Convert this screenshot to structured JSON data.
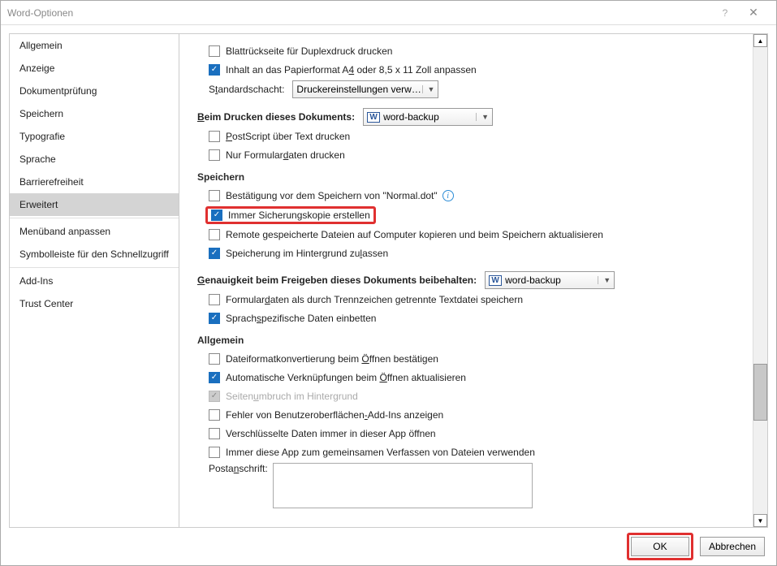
{
  "titlebar": {
    "title": "Word-Optionen",
    "help": "?",
    "close": "✕"
  },
  "sidebar": {
    "items": [
      {
        "label": "Allgemein"
      },
      {
        "label": "Anzeige"
      },
      {
        "label": "Dokumentprüfung"
      },
      {
        "label": "Speichern"
      },
      {
        "label": "Typografie"
      },
      {
        "label": "Sprache"
      },
      {
        "label": "Barrierefreiheit"
      },
      {
        "label": "Erweitert",
        "selected": true
      },
      {
        "sep": true
      },
      {
        "label": "Menüband anpassen"
      },
      {
        "label": "Symbolleiste für den Schnellzugriff"
      },
      {
        "sep": true
      },
      {
        "label": "Add-Ins"
      },
      {
        "label": "Trust Center"
      }
    ]
  },
  "content": {
    "duplex_cb": "Blattrückseite für Duplexdruck drucken",
    "paperfit_cb": "Inhalt an das Papierformat A4 oder 8,5 x 11 Zoll anpassen",
    "standardschacht_label": "Standardschacht:",
    "standardschacht_val": "Druckereinstellungen verw…",
    "print_doc_label": "Beim Drucken dieses Dokuments:",
    "print_doc_val": "word-backup",
    "postscript_cb": "PostScript über Text drucken",
    "formonly_cb": "Nur Formulardaten drucken",
    "save_hdr": "Speichern",
    "confirm_normal_cb": "Bestätigung vor dem Speichern von \"Normal.dot\"",
    "backup_cb": "Immer Sicherungskopie erstellen",
    "remote_cb": "Remote gespeicherte Dateien auf Computer kopieren und beim Speichern aktualisieren",
    "bg_save_cb": "Speicherung im Hintergrund zulassen",
    "fidelity_label": "Genauigkeit beim Freigeben dieses Dokuments beibehalten:",
    "fidelity_val": "word-backup",
    "formdata_cb": "Formulardaten als durch Trennzeichen getrennte Textdatei speichern",
    "lang_cb": "Sprachspezifische Daten einbetten",
    "general_hdr": "Allgemein",
    "fileconv_cb": "Dateiformatkonvertierung beim Öffnen bestätigen",
    "autolinks_cb": "Automatische Verknüpfungen beim Öffnen aktualisieren",
    "pagebreak_cb": "Seitenumbruch im Hintergrund",
    "addin_err_cb": "Fehler von Benutzeroberflächen-Add-Ins anzeigen",
    "encrypted_cb": "Verschlüsselte Daten immer in dieser App öffnen",
    "coauth_cb": "Immer diese App zum gemeinsamen Verfassen von Dateien verwenden",
    "post_label": "Postanschrift:"
  },
  "footer": {
    "ok": "OK",
    "cancel": "Abbrechen"
  }
}
